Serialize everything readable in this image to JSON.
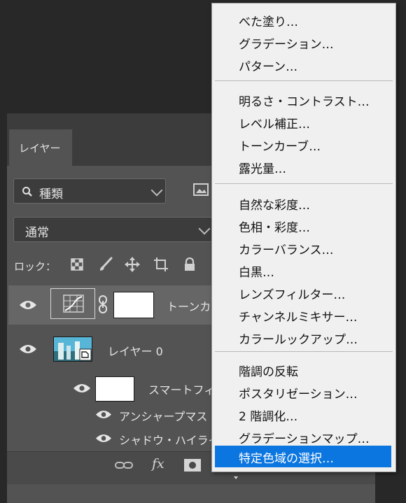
{
  "layers_panel": {
    "tab_label": "レイヤー",
    "filter_kind": "種類",
    "blend_mode": "通常",
    "lock_label": "ロック：",
    "layers": [
      {
        "name": "トーンカ",
        "type": "adjustment"
      },
      {
        "name": "レイヤー 0",
        "type": "smart-object"
      }
    ],
    "smart_filters_label": "スマートフィ",
    "filters": [
      "アンシャープマス",
      "シャドウ・ハイライ"
    ],
    "bottom_icons": [
      "link-icon",
      "fx-icon",
      "mask-icon",
      "adjustment-icon",
      "folder-icon",
      "new-layer-icon",
      "trash-icon"
    ],
    "fx_label": "fx"
  },
  "adjustment_menu": {
    "groups": [
      [
        "べた塗り…",
        "グラデーション…",
        "パターン…"
      ],
      [
        "明るさ・コントラスト…",
        "レベル補正…",
        "トーンカーブ…",
        "露光量…"
      ],
      [
        "自然な彩度…",
        "色相・彩度…",
        "カラーバランス…",
        "白黒…",
        "レンズフィルター…",
        "チャンネルミキサー…",
        "カラールックアップ…"
      ],
      [
        "階調の反転",
        "ポスタリゼーション…",
        "2 階調化…",
        "グラデーションマップ…",
        "特定色域の選択…"
      ]
    ],
    "highlighted_item": "特定色域の選択…",
    "highlight_color": "#0b76e0"
  }
}
